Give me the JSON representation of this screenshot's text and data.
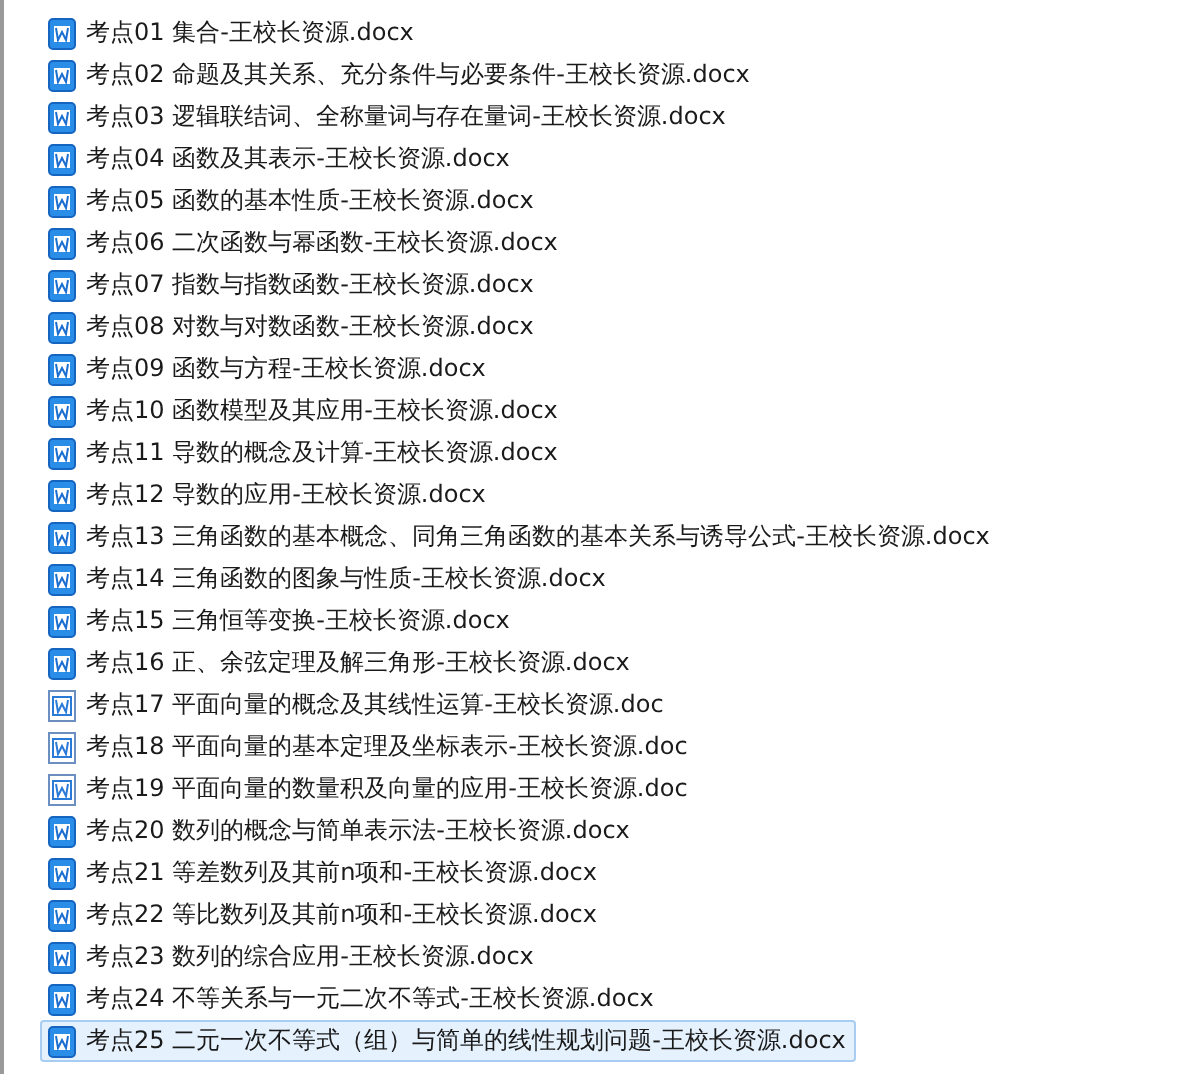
{
  "files": [
    {
      "name": "考点01 集合-王校长资源.docx",
      "kind": "docx",
      "selected": false
    },
    {
      "name": "考点02 命题及其关系、充分条件与必要条件-王校长资源.docx",
      "kind": "docx",
      "selected": false
    },
    {
      "name": "考点03 逻辑联结词、全称量词与存在量词-王校长资源.docx",
      "kind": "docx",
      "selected": false
    },
    {
      "name": "考点04 函数及其表示-王校长资源.docx",
      "kind": "docx",
      "selected": false
    },
    {
      "name": "考点05 函数的基本性质-王校长资源.docx",
      "kind": "docx",
      "selected": false
    },
    {
      "name": "考点06 二次函数与幂函数-王校长资源.docx",
      "kind": "docx",
      "selected": false
    },
    {
      "name": "考点07 指数与指数函数-王校长资源.docx",
      "kind": "docx",
      "selected": false
    },
    {
      "name": "考点08 对数与对数函数-王校长资源.docx",
      "kind": "docx",
      "selected": false
    },
    {
      "name": "考点09 函数与方程-王校长资源.docx",
      "kind": "docx",
      "selected": false
    },
    {
      "name": "考点10 函数模型及其应用-王校长资源.docx",
      "kind": "docx",
      "selected": false
    },
    {
      "name": "考点11 导数的概念及计算-王校长资源.docx",
      "kind": "docx",
      "selected": false
    },
    {
      "name": "考点12 导数的应用-王校长资源.docx",
      "kind": "docx",
      "selected": false
    },
    {
      "name": "考点13 三角函数的基本概念、同角三角函数的基本关系与诱导公式-王校长资源.docx",
      "kind": "docx",
      "selected": false
    },
    {
      "name": "考点14 三角函数的图象与性质-王校长资源.docx",
      "kind": "docx",
      "selected": false
    },
    {
      "name": "考点15 三角恒等变换-王校长资源.docx",
      "kind": "docx",
      "selected": false
    },
    {
      "name": "考点16 正、余弦定理及解三角形-王校长资源.docx",
      "kind": "docx",
      "selected": false
    },
    {
      "name": "考点17 平面向量的概念及其线性运算-王校长资源.doc",
      "kind": "doc",
      "selected": false
    },
    {
      "name": "考点18 平面向量的基本定理及坐标表示-王校长资源.doc",
      "kind": "doc",
      "selected": false
    },
    {
      "name": "考点19 平面向量的数量积及向量的应用-王校长资源.doc",
      "kind": "doc",
      "selected": false
    },
    {
      "name": "考点20 数列的概念与简单表示法-王校长资源.docx",
      "kind": "docx",
      "selected": false
    },
    {
      "name": "考点21 等差数列及其前n项和-王校长资源.docx",
      "kind": "docx",
      "selected": false
    },
    {
      "name": "考点22 等比数列及其前n项和-王校长资源.docx",
      "kind": "docx",
      "selected": false
    },
    {
      "name": "考点23 数列的综合应用-王校长资源.docx",
      "kind": "docx",
      "selected": false
    },
    {
      "name": "考点24 不等关系与一元二次不等式-王校长资源.docx",
      "kind": "docx",
      "selected": false
    },
    {
      "name": "考点25 二元一次不等式（组）与简单的线性规划问题-王校长资源.docx",
      "kind": "docx",
      "selected": true
    }
  ]
}
